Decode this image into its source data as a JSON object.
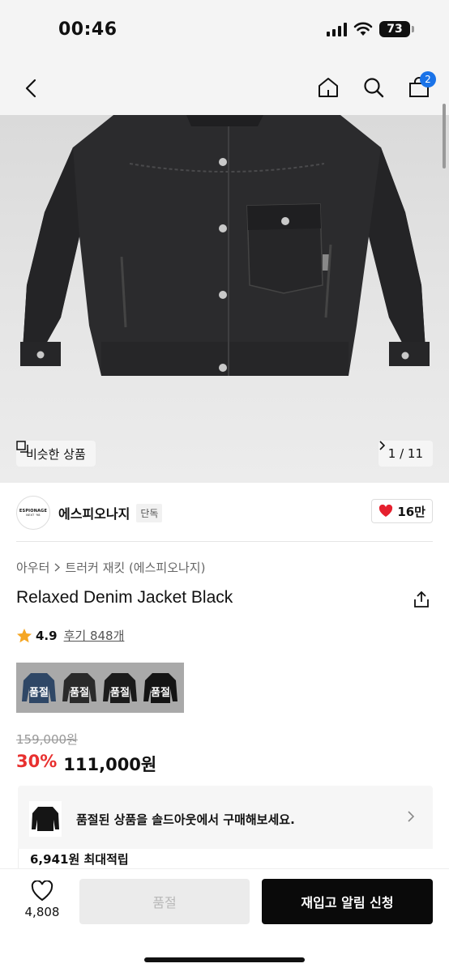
{
  "status_bar": {
    "time": "00:46",
    "battery": "73"
  },
  "nav": {
    "cart_count": "2",
    "back_icon": "chevron-left-icon",
    "home_icon": "home-icon",
    "search_icon": "search-icon",
    "cart_icon": "shopping-bag-icon"
  },
  "gallery": {
    "similar_label": "비슷한 상품",
    "page_indicator": "1 / 11"
  },
  "brand": {
    "logo_text": "ESPIONAGE",
    "logo_sub": "NEXT '98",
    "name": "에스피오나지",
    "tag": "단독",
    "likes": "16만"
  },
  "breadcrumb": {
    "category": "아우터",
    "subcategory": "트러커 재킷 (에스피오나지)"
  },
  "product": {
    "title": "Relaxed Denim Jacket Black",
    "rating": "4.9",
    "reviews": "후기 848개"
  },
  "swatches": [
    {
      "label": "품절",
      "color": "#2f4766"
    },
    {
      "label": "품절",
      "color": "#2a2a2a"
    },
    {
      "label": "품절",
      "color": "#1b1b1b"
    },
    {
      "label": "품절",
      "color": "#141414"
    }
  ],
  "price": {
    "original": "159,000원",
    "discount": "30%",
    "sale": "111,000원"
  },
  "soldout_notice": {
    "message": "품절된 상품을 솔드아웃에서 구매해보세요."
  },
  "points": {
    "text": "6,941원 최대적립"
  },
  "bottom_bar": {
    "wish_count": "4,808",
    "sold_label": "품절",
    "restock_label": "재입고 알림 신청"
  },
  "colors": {
    "accent_red": "#e8302f",
    "badge_blue": "#1a73e8",
    "heart_red": "#e5202e"
  }
}
